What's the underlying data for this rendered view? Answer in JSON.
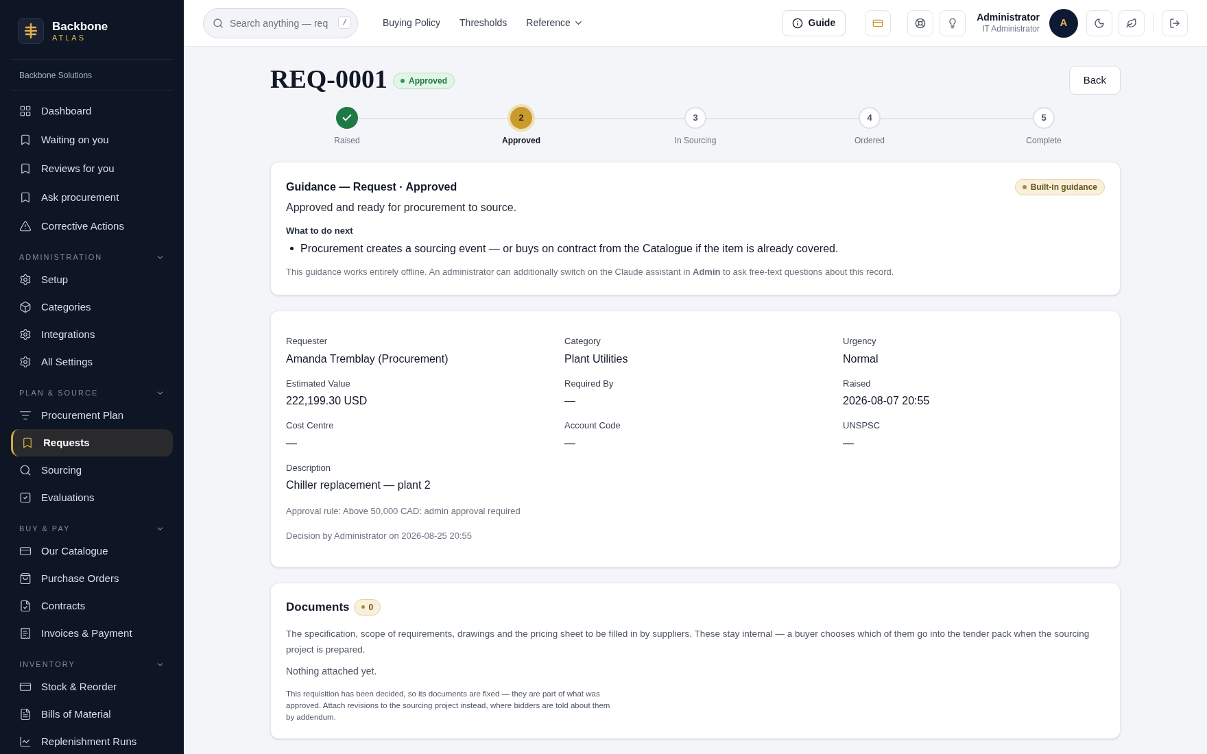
{
  "brand": {
    "name": "Backbone",
    "subtitle": "ATLAS",
    "org": "Backbone Solutions"
  },
  "sidebar": {
    "items": [
      {
        "label": "Dashboard",
        "selected": false
      },
      {
        "label": "Waiting on you",
        "selected": false
      },
      {
        "label": "Reviews for you",
        "selected": false
      },
      {
        "label": "Ask procurement",
        "selected": false
      },
      {
        "label": "Corrective Actions",
        "selected": false
      }
    ],
    "sections": [
      {
        "title": "ADMINISTRATION",
        "expanded": true,
        "items": [
          {
            "label": "Setup",
            "selected": false
          },
          {
            "label": "Categories",
            "selected": false
          },
          {
            "label": "Integrations",
            "selected": false
          },
          {
            "label": "All Settings",
            "selected": false
          }
        ]
      },
      {
        "title": "PLAN & SOURCE",
        "expanded": true,
        "items": [
          {
            "label": "Procurement Plan",
            "selected": false
          },
          {
            "label": "Requests",
            "selected": true
          },
          {
            "label": "Sourcing",
            "selected": false
          },
          {
            "label": "Evaluations",
            "selected": false
          }
        ]
      },
      {
        "title": "BUY & PAY",
        "expanded": true,
        "items": [
          {
            "label": "Our Catalogue",
            "selected": false
          },
          {
            "label": "Purchase Orders",
            "selected": false
          },
          {
            "label": "Contracts",
            "selected": false
          },
          {
            "label": "Invoices & Payment",
            "selected": false
          }
        ]
      },
      {
        "title": "INVENTORY",
        "expanded": true,
        "items": [
          {
            "label": "Stock & Reorder",
            "selected": false
          },
          {
            "label": "Bills of Material",
            "selected": false
          },
          {
            "label": "Replenishment Runs",
            "selected": false
          }
        ]
      }
    ]
  },
  "topbar": {
    "search": {
      "placeholder": "Search anything — req",
      "shortcut": "/"
    },
    "links": [
      {
        "label": "Buying Policy",
        "dropdown": false
      },
      {
        "label": "Thresholds",
        "dropdown": false
      },
      {
        "label": "Reference",
        "dropdown": true
      }
    ],
    "guide": "Guide",
    "user": {
      "name": "Administrator",
      "role": "IT Administrator",
      "initial": "A"
    }
  },
  "page": {
    "title": "REQ-0001",
    "status": "Approved",
    "back": "Back"
  },
  "steps": [
    {
      "label": "Raised",
      "kind": "done"
    },
    {
      "number": "2",
      "label": "Approved",
      "kind": "current"
    },
    {
      "number": "3",
      "label": "In Sourcing",
      "kind": "pending"
    },
    {
      "number": "4",
      "label": "Ordered",
      "kind": "pending"
    },
    {
      "number": "5",
      "label": "Complete",
      "kind": "pending"
    }
  ],
  "guidance": {
    "title": "Guidance — Request · Approved",
    "badge": "Built-in guidance",
    "summary": "Approved and ready for procurement to source.",
    "next_heading": "What to do next",
    "bullets": [
      "Procurement creates a sourcing event — or buys on contract from the Catalogue if the item is already covered."
    ],
    "note": "This guidance works entirely offline. An administrator can additionally switch on the Claude assistant in **Admin** to ask free-text questions about this record."
  },
  "details": {
    "fields": [
      {
        "label": "Requester",
        "value": "Amanda Tremblay (Procurement)"
      },
      {
        "label": "Category",
        "value": "Plant Utilities"
      },
      {
        "label": "Urgency",
        "value": "Normal"
      },
      {
        "label": "Estimated Value",
        "value": "222,199.30 USD"
      },
      {
        "label": "Required By",
        "value": "—"
      },
      {
        "label": "Raised",
        "value": "2026-08-07 20:55"
      },
      {
        "label": "Cost Centre",
        "value": "—"
      },
      {
        "label": "Account Code",
        "value": "—"
      },
      {
        "label": "UNSPSC",
        "value": "—"
      },
      {
        "label": "Description",
        "value": "Chiller replacement — plant 2"
      }
    ],
    "notes": [
      "Approval rule: Above 50,000 CAD: admin approval required",
      "Decision by Administrator on 2026-08-25 20:55"
    ]
  },
  "documents": {
    "title": "Documents",
    "count": "0",
    "intro": "The specification, scope of requirements, drawings and the pricing sheet to be filled in by suppliers. These stay internal — a buyer chooses which of them go into the tender pack when the sourcing project is prepared.",
    "empty": "Nothing attached yet.",
    "locked_note": "This requisition has been decided, so its documents are fixed — they are part of what was approved. Attach revisions to the sourcing project instead, where bidders are told about them by addendum."
  }
}
